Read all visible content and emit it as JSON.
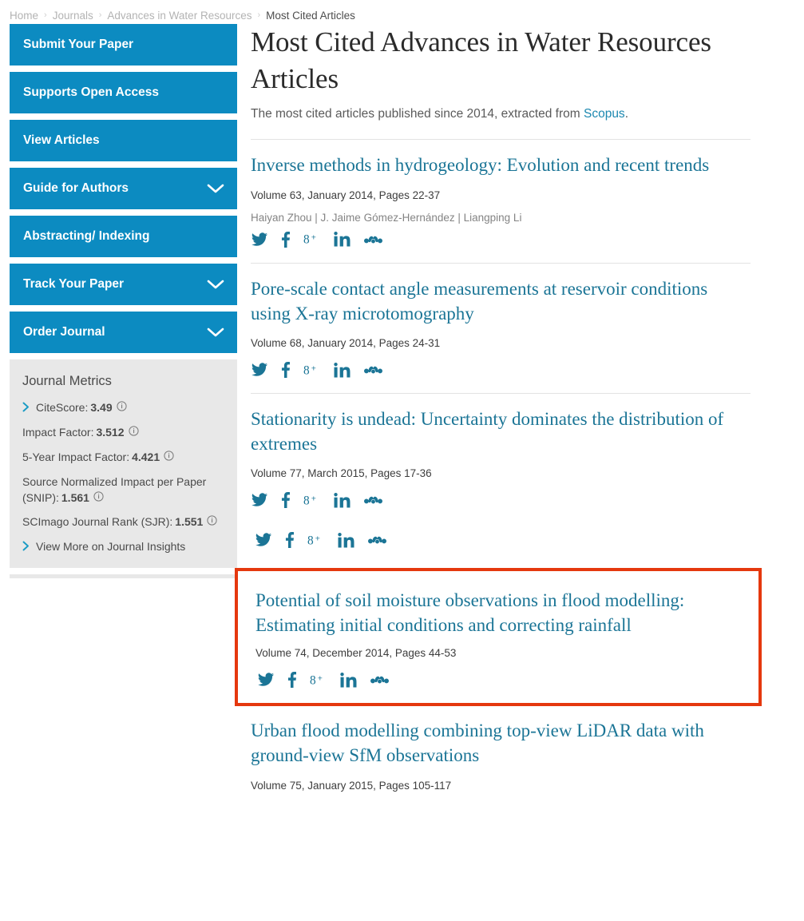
{
  "breadcrumb": {
    "items": [
      {
        "label": "Home",
        "current": false
      },
      {
        "label": "Journals",
        "current": false
      },
      {
        "label": "Advances in Water Resources",
        "current": false
      },
      {
        "label": "Most Cited Articles",
        "current": true
      }
    ],
    "separator": "›"
  },
  "sidebar": {
    "nav": [
      {
        "label": "Submit Your Paper",
        "chevron": false
      },
      {
        "label": "Supports Open Access",
        "chevron": false
      },
      {
        "label": "View Articles",
        "chevron": false
      },
      {
        "label": "Guide for Authors",
        "chevron": true
      },
      {
        "label": "Abstracting/ Indexing",
        "chevron": false
      },
      {
        "label": "Track Your Paper",
        "chevron": true
      },
      {
        "label": "Order Journal",
        "chevron": true
      }
    ],
    "metrics": {
      "title": "Journal Metrics",
      "rows": [
        {
          "label": "CiteScore:",
          "value": "3.49",
          "chevron": true,
          "info": true
        },
        {
          "label": "Impact Factor:",
          "value": "3.512",
          "chevron": false,
          "info": true
        },
        {
          "label": "5-Year Impact Factor:",
          "value": "4.421",
          "chevron": false,
          "info": true
        },
        {
          "label": "Source Normalized Impact per Paper (SNIP):",
          "value": "1.561",
          "chevron": false,
          "info": true
        },
        {
          "label": "SCImago Journal Rank (SJR):",
          "value": "1.551",
          "chevron": false,
          "info": true
        }
      ],
      "view_more": "View More on Journal Insights"
    }
  },
  "main": {
    "title": "Most Cited Advances in Water Resources Articles",
    "subtitle_before": "The most cited articles published since 2014, extracted from ",
    "subtitle_link": "Scopus",
    "subtitle_after": ".",
    "social_labels": {
      "twitter": "Twitter",
      "facebook": "Facebook",
      "googleplus": "Google Plus",
      "linkedin": "LinkedIn",
      "mendeley": "Mendeley"
    },
    "articles": [
      {
        "title": "Inverse methods in hydrogeology: Evolution and recent trends",
        "meta": "Volume 63, January 2014, Pages 22-37",
        "authors": "Haiyan Zhou | J. Jaime Gómez-Hernández | Liangping Li",
        "highlighted": false
      },
      {
        "title": "Pore-scale contact angle measurements at reservoir conditions using X-ray microtomography",
        "meta": "Volume 68, January 2014, Pages 24-31",
        "authors": "",
        "highlighted": false
      },
      {
        "title": "Stationarity is undead: Uncertainty dominates the distribution of extremes",
        "meta": "Volume 77, March 2015, Pages 17-36",
        "authors": "",
        "highlighted": false
      },
      {
        "title": "Potential of soil moisture observations in flood modelling: Estimating initial conditions and correcting rainfall",
        "meta": "Volume 74, December 2014, Pages 44-53",
        "authors": "",
        "highlighted": true
      },
      {
        "title": "Urban flood modelling combining top-view LiDAR data with ground-view SfM observations",
        "meta": "Volume 75, January 2015, Pages 105-117",
        "authors": "",
        "highlighted": false
      }
    ]
  },
  "colors": {
    "sidebar_blue": "#0c8bc1",
    "link_teal": "#1b7596",
    "highlight_red": "#e5380e",
    "metrics_bg": "#e8e8e8"
  }
}
